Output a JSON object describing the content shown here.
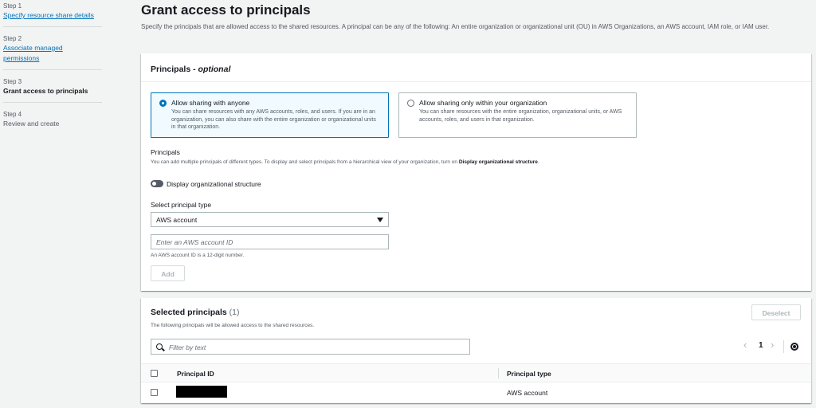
{
  "wizard": {
    "steps": [
      {
        "num": "Step 1",
        "title": "Specify resource share details"
      },
      {
        "num": "Step 2",
        "title": "Associate managed permissions"
      },
      {
        "num": "Step 3",
        "title": "Grant access to principals"
      },
      {
        "num": "Step 4",
        "title": "Review and create"
      }
    ]
  },
  "header": {
    "title": "Grant access to principals",
    "description": "Specify the principals that are allowed access to the shared resources. A principal can be any of the following: An entire organization or organizational unit (OU) in AWS Organizations, an AWS account, IAM role, or IAM user."
  },
  "principals_panel": {
    "title": "Principals -",
    "title_optional": "optional",
    "tiles": [
      {
        "label": "Allow sharing with anyone",
        "desc": "You can share resources with any AWS accounts, roles, and users. If you are in an organization, you can also share with the entire organization or organizational units in that organization."
      },
      {
        "label": "Allow sharing only within your organization",
        "desc": "You can share resources with the entire organization, organizational units, or AWS accounts, roles, and users in that organization."
      }
    ],
    "principals_label": "Principals",
    "principals_hint": "You can add multiple principals of different types. To display and select principals from a hierarchical view of your organization, turn on",
    "principals_hint_bold": "Display organizational structure",
    "toggle_label": "Display organizational structure",
    "select_label": "Select principal type",
    "select_value": "AWS account",
    "input_placeholder": "Enter an AWS account ID",
    "input_hint": "An AWS account ID is a 12-digit number.",
    "add_button": "Add"
  },
  "selected_panel": {
    "title": "Selected principals",
    "count": "(1)",
    "description": "The following principals will be allowed access to the shared resources.",
    "deselect_button": "Deselect",
    "filter_placeholder": "Filter by text",
    "page": "1",
    "columns": [
      "Principal ID",
      "Principal type"
    ],
    "rows": [
      {
        "principal_type": "AWS account"
      }
    ]
  }
}
